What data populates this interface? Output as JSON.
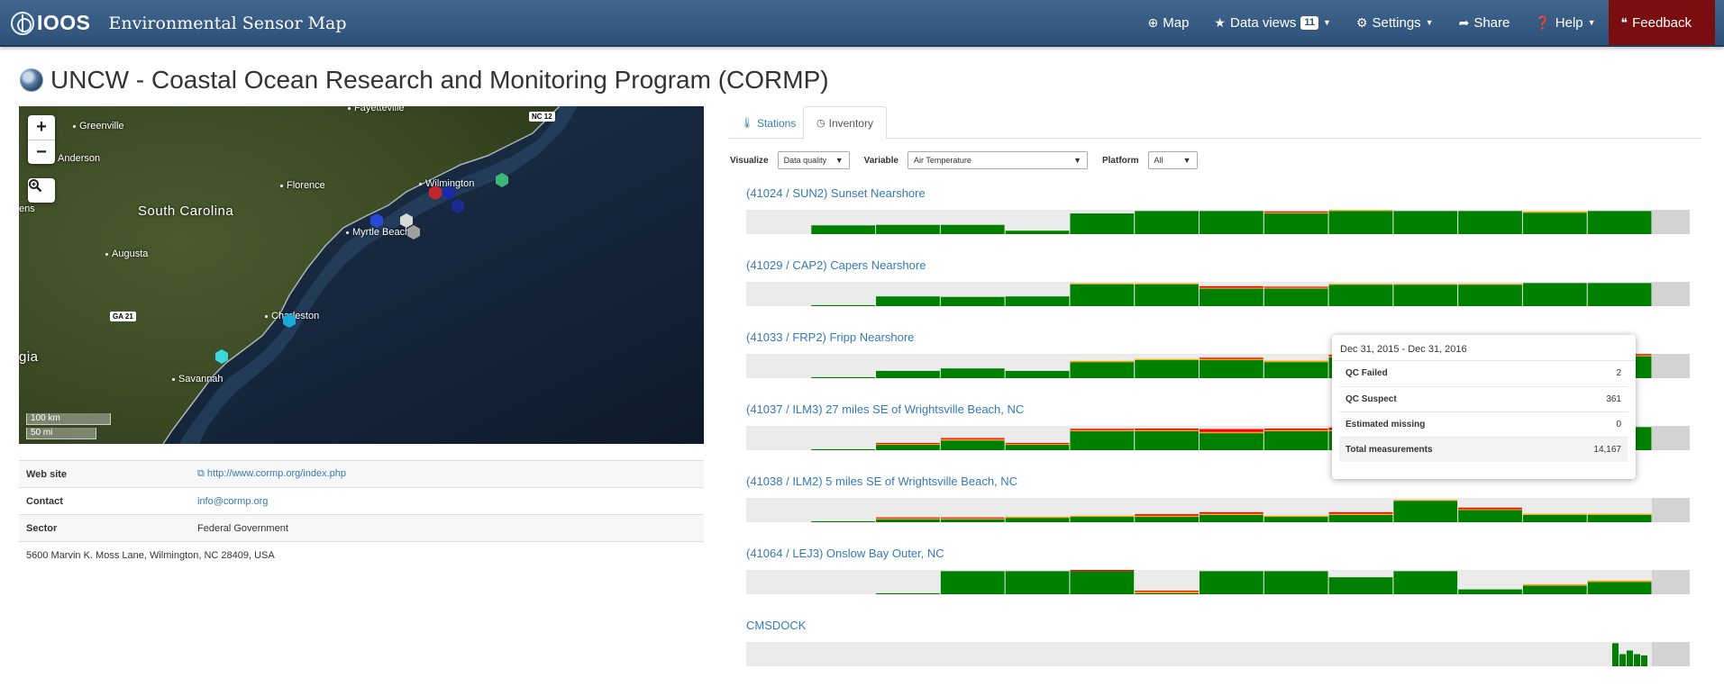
{
  "navbar": {
    "logo_text": "IOOS",
    "app_title": "Environmental Sensor Map",
    "items": [
      {
        "icon": "globe-icon",
        "glyph": "⊕",
        "label": "Map",
        "caret": false
      },
      {
        "icon": "star-icon",
        "glyph": "★",
        "label": "Data views",
        "badge": "11",
        "caret": true
      },
      {
        "icon": "gear-icon",
        "glyph": "⚙",
        "label": "Settings",
        "caret": true
      },
      {
        "icon": "share-icon",
        "glyph": "➦",
        "label": "Share",
        "caret": false
      },
      {
        "icon": "help-icon",
        "glyph": "❓",
        "label": "Help",
        "caret": true
      },
      {
        "icon": "bullhorn-icon",
        "glyph": "❝",
        "label": "Feedback",
        "caret": false
      }
    ]
  },
  "page": {
    "title": "UNCW - Coastal Ocean Research and Monitoring Program (CORMP)"
  },
  "map": {
    "zoom_in": "+",
    "zoom_out": "−",
    "labels": {
      "fayetteville": "Fayetteville",
      "greenville": "Greenville",
      "anderson": "Anderson",
      "florence": "Florence",
      "wilmington": "Wilmington",
      "south_carolina": "South Carolina",
      "myrtle_beach": "Myrtle Beach",
      "augusta": "Augusta",
      "charleston": "Charleston",
      "savannah": "Savannah",
      "gia": "gia",
      "ens": "ens",
      "ga21": "GA 21",
      "nc12": "NC 12"
    },
    "scale_km": "100 km",
    "scale_mi": "50 mi"
  },
  "info": {
    "rows": [
      {
        "key": "Web site",
        "value": "http://www.cormp.org/index.php",
        "link": true
      },
      {
        "key": "Contact",
        "value": "info@cormp.org",
        "link": true
      },
      {
        "key": "Sector",
        "value": "Federal Government",
        "link": false
      }
    ],
    "address": "5600 Marvin K. Moss Lane, Wilmington, NC 28409, USA"
  },
  "tabs": [
    {
      "label": "Stations",
      "icon": "thermometer-icon",
      "glyph": "🌡",
      "active": false
    },
    {
      "label": "Inventory",
      "icon": "clock-icon",
      "glyph": "◷",
      "active": true
    }
  ],
  "filters": {
    "visualize_label": "Visualize",
    "visualize_value": "Data quality",
    "variable_label": "Variable",
    "variable_value": "Air Temperature",
    "platform_label": "Platform",
    "platform_value": "All"
  },
  "colors": {
    "good": "#008000",
    "suspect": "#ffa500",
    "failed": "#ff0000",
    "track": "#ebebeb",
    "end_cap": "#d3d3d3",
    "link": "#337ab7"
  },
  "chart_data": {
    "type": "bar",
    "title": "",
    "periods": 14,
    "series_note": "",
    "stations": [
      {
        "name": "(41024 / SUN2) Sunset Nearshore",
        "good": [
          0,
          0.36,
          0.38,
          0.38,
          0.14,
          0.85,
          0.95,
          0.95,
          0.85,
          0.95,
          0.95,
          0.95,
          0.88,
          0.95
        ],
        "suspect": [
          0,
          0,
          0,
          0,
          0,
          0,
          0,
          0,
          0.04,
          0.04,
          0,
          0,
          0.05,
          0
        ],
        "failed": [
          0,
          0,
          0,
          0,
          0,
          0,
          0,
          0,
          0.04,
          0,
          0,
          0,
          0,
          0
        ]
      },
      {
        "name": "(41029 / CAP2) Capers Nearshore",
        "good": [
          0,
          0.04,
          0.4,
          0.38,
          0.4,
          0.9,
          0.9,
          0.72,
          0.72,
          0.88,
          0.88,
          0.88,
          0.95,
          0.95
        ],
        "suspect": [
          0,
          0,
          0,
          0,
          0,
          0.04,
          0.04,
          0.04,
          0.04,
          0.04,
          0.04,
          0.04,
          0,
          0
        ],
        "failed": [
          0,
          0,
          0,
          0,
          0,
          0,
          0,
          0.06,
          0.04,
          0,
          0,
          0,
          0,
          0
        ]
      },
      {
        "name": "(41033 / FRP2) Fripp Nearshore",
        "good": [
          0,
          0.04,
          0.3,
          0.4,
          0.3,
          0.66,
          0.74,
          0.74,
          0.66,
          0.85,
          0.9,
          0.9,
          0.9,
          0.9
        ],
        "suspect": [
          0,
          0,
          0,
          0,
          0,
          0.05,
          0.05,
          0.05,
          0.06,
          0.06,
          0.04,
          0.04,
          0.04,
          0.04
        ],
        "failed": [
          0,
          0,
          0,
          0,
          0,
          0,
          0,
          0.05,
          0,
          0.05,
          0,
          0,
          0,
          0.05
        ]
      },
      {
        "name": "(41037 / ILM3) 27 miles SE of Wrightsville Beach, NC",
        "good": [
          0,
          0.04,
          0.22,
          0.4,
          0.22,
          0.78,
          0.78,
          0.7,
          0.78,
          0.78,
          0.85,
          0.85,
          0.85,
          0.95
        ],
        "suspect": [
          0,
          0,
          0.04,
          0.05,
          0.04,
          0.05,
          0.05,
          0.05,
          0.05,
          0.05,
          0.04,
          0.04,
          0.04,
          0
        ],
        "failed": [
          0,
          0,
          0.04,
          0.05,
          0.04,
          0.05,
          0.06,
          0.12,
          0.06,
          0.1,
          0,
          0,
          0,
          0
        ]
      },
      {
        "name": "(41038 / ILM2) 5 miles SE of Wrightsville Beach, NC",
        "good": [
          0,
          0.04,
          0.12,
          0.12,
          0.18,
          0.22,
          0.22,
          0.3,
          0.22,
          0.3,
          0.88,
          0.5,
          0.3,
          0.3
        ],
        "suspect": [
          0,
          0,
          0.04,
          0.04,
          0.05,
          0.05,
          0.05,
          0.05,
          0.05,
          0.05,
          0.04,
          0.04,
          0.05,
          0.05
        ],
        "failed": [
          0,
          0,
          0.04,
          0.04,
          0,
          0,
          0.06,
          0.06,
          0,
          0.06,
          0,
          0.06,
          0,
          0
        ]
      },
      {
        "name": "(41064 / LEJ3) Onslow Bay Outer, NC",
        "good": [
          0,
          0,
          0.04,
          0.95,
          0.95,
          0.95,
          0.05,
          0.95,
          0.95,
          0.7,
          0.95,
          0.2,
          0.35,
          0.5
        ],
        "suspect": [
          0,
          0,
          0,
          0,
          0,
          0,
          0.06,
          0,
          0,
          0,
          0,
          0,
          0.06,
          0.06
        ],
        "failed": [
          0,
          0,
          0,
          0,
          0,
          0.06,
          0.04,
          0,
          0,
          0,
          0,
          0,
          0,
          0
        ]
      },
      {
        "name": "CMSDOCK",
        "good": [
          0,
          0,
          0,
          0,
          0,
          0,
          0,
          0,
          0,
          0,
          0,
          0,
          0,
          0
        ],
        "suspect": [
          0,
          0,
          0,
          0,
          0,
          0,
          0,
          0,
          0,
          0,
          0,
          0,
          0,
          0
        ],
        "failed": [
          0,
          0,
          0,
          0,
          0,
          0,
          0,
          0,
          0,
          0,
          0,
          0,
          0,
          0
        ],
        "tail_spikes": [
          0.95,
          0.5,
          0.65,
          0.5,
          0.45
        ]
      }
    ]
  },
  "tooltip": {
    "date_range": "Dec 31, 2015 - Dec 31, 2016",
    "rows": [
      {
        "key": "QC Failed",
        "value": "2"
      },
      {
        "key": "QC Suspect",
        "value": "361"
      },
      {
        "key": "Estimated missing",
        "value": "0"
      },
      {
        "key": "Total measurements",
        "value": "14,167"
      }
    ]
  }
}
